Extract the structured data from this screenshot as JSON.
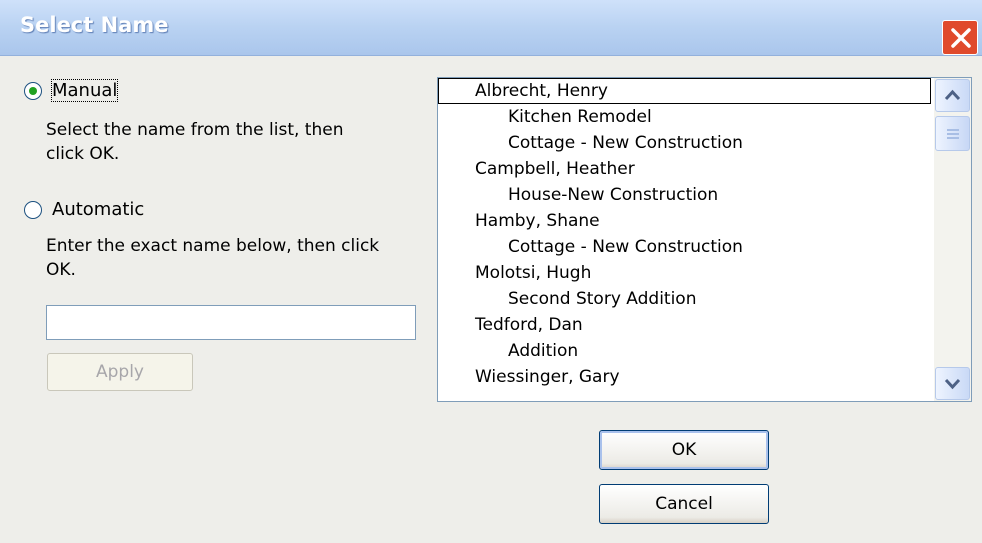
{
  "window": {
    "title": "Select Name",
    "close_icon": "close-icon"
  },
  "manual": {
    "label": "Manual",
    "selected": true,
    "help_line1": "Select the name from the list, then",
    "help_line2": "click OK."
  },
  "automatic": {
    "label": "Automatic",
    "selected": false,
    "help_line1": "Enter the exact name below, then click",
    "help_line2": "OK.",
    "input_value": "",
    "apply_label": "Apply"
  },
  "list": {
    "items": [
      {
        "text": "Albrecht, Henry",
        "level": 0,
        "selected": true
      },
      {
        "text": "Kitchen Remodel",
        "level": 1
      },
      {
        "text": "Cottage - New Construction",
        "level": 1
      },
      {
        "text": "Campbell, Heather",
        "level": 0
      },
      {
        "text": "House-New Construction",
        "level": 1
      },
      {
        "text": "Hamby, Shane",
        "level": 0
      },
      {
        "text": "Cottage - New Construction",
        "level": 1
      },
      {
        "text": "Molotsi, Hugh",
        "level": 0
      },
      {
        "text": "Second Story Addition",
        "level": 1
      },
      {
        "text": "Tedford, Dan",
        "level": 0
      },
      {
        "text": "Addition",
        "level": 1
      },
      {
        "text": "Wiessinger, Gary",
        "level": 0
      }
    ]
  },
  "buttons": {
    "ok": "OK",
    "cancel": "Cancel"
  }
}
